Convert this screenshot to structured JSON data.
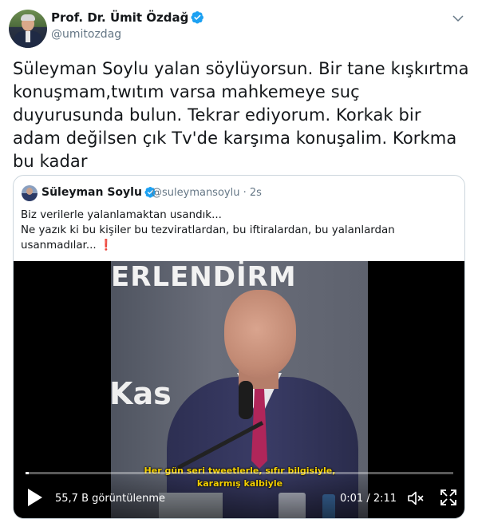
{
  "author": {
    "name": "Prof. Dr. Ümit Özdağ",
    "handle": "@umitozdag",
    "avatar_icon": "profile-photo",
    "verified_icon": "verified-badge-icon"
  },
  "menu_icon": "chevron-down-icon",
  "tweet": {
    "text": "Süleyman Soylu yalan söylüyorsun. Bir tane kışkırtma konuşmam,twıtım varsa mahkemeye suç duyurusunda bulun. Tekrar ediyorum. Korkak bir adam değilsen çık Tv'de karşıma konuşalim. Korkma bu kadar"
  },
  "quoted": {
    "name": "Süleyman Soylu",
    "handle_time": "@suleymansoylu · 2s",
    "lines": [
      "Biz verilerle yalanlamaktan usandık...",
      "Ne yazık ki bu kişiler bu tezviratlardan, bu iftiralardan, bu yalanlardan",
      "usanmadılar..."
    ],
    "emoji": "❗",
    "video": {
      "banner_text": "ERLENDİRM",
      "banner_text_2": "Kas",
      "subtitle_1": "Her gün seri tweetlerle, sıfır bilgisiyle,",
      "subtitle_2": "kararmış kalbiyle",
      "views": "55,7 B görüntülenme",
      "time": "0:01 / 2:11",
      "progress": 0.008
    }
  },
  "colors": {
    "text": "#14171a",
    "secondary": "#657786",
    "verified": "#1da1f2",
    "subtitle": "#f4d000"
  }
}
